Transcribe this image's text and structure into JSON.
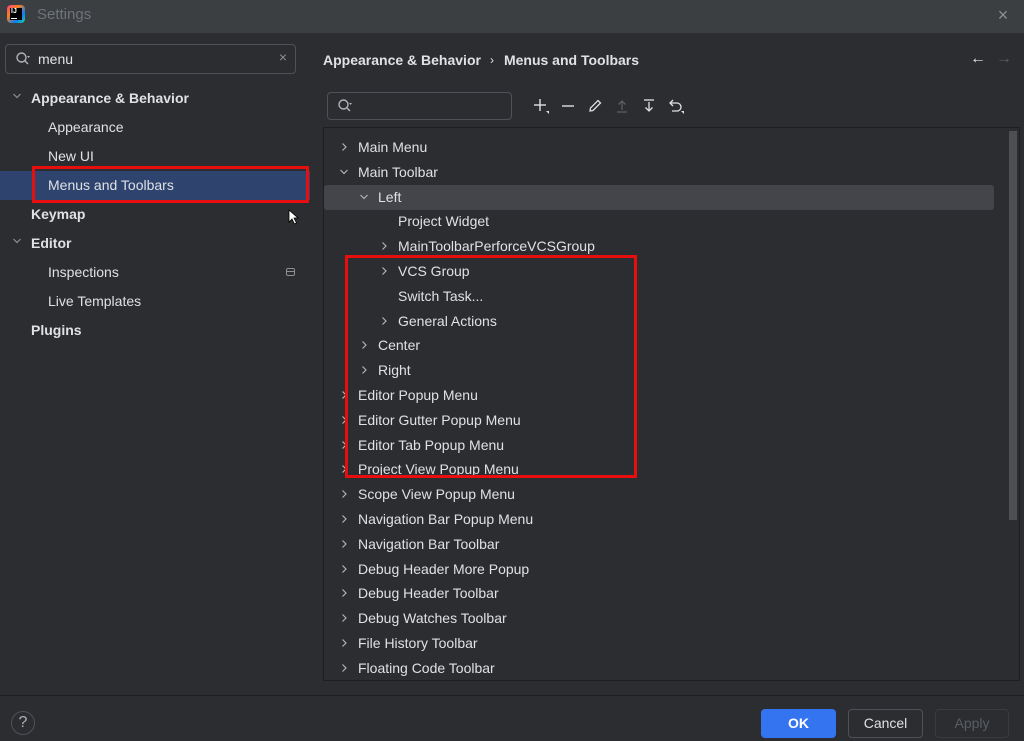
{
  "window": {
    "title": "Settings",
    "close_label": "×"
  },
  "sidebar": {
    "search": {
      "value": "menu",
      "clear_label": "×"
    },
    "items": [
      {
        "label": "Appearance & Behavior",
        "level": 0,
        "bold": true,
        "expanded": true
      },
      {
        "label": "Appearance",
        "level": 1,
        "bold": false
      },
      {
        "label": "New UI",
        "level": 1,
        "bold": false
      },
      {
        "label": "Menus and Toolbars",
        "level": 1,
        "bold": false,
        "selected": true
      },
      {
        "label": "Keymap",
        "level": 0,
        "bold": true
      },
      {
        "label": "Editor",
        "level": 0,
        "bold": true,
        "expanded": true
      },
      {
        "label": "Inspections",
        "level": 1,
        "bold": false,
        "badge_icon": "project-settings-icon"
      },
      {
        "label": "Live Templates",
        "level": 1,
        "bold": false
      },
      {
        "label": "Plugins",
        "level": 0,
        "bold": true
      }
    ]
  },
  "main": {
    "breadcrumb": [
      "Appearance & Behavior",
      "Menus and Toolbars"
    ],
    "breadcrumb_separator": "›",
    "nav": {
      "back": "←",
      "forward": "→"
    },
    "tree_search": {
      "value": "",
      "placeholder": ""
    },
    "toolbar": [
      {
        "name": "add-icon",
        "enabled": true
      },
      {
        "name": "remove-icon",
        "enabled": true
      },
      {
        "name": "edit-icon",
        "enabled": true
      },
      {
        "name": "move-up-icon",
        "enabled": false
      },
      {
        "name": "move-down-icon",
        "enabled": true
      },
      {
        "name": "restore-icon",
        "enabled": true
      }
    ],
    "tree": [
      {
        "label": "Main Menu",
        "level": 0,
        "has_children": true,
        "expanded": false
      },
      {
        "label": "Main Toolbar",
        "level": 0,
        "has_children": true,
        "expanded": true
      },
      {
        "label": "Left",
        "level": 1,
        "has_children": true,
        "expanded": true,
        "selected": true
      },
      {
        "label": "Project Widget",
        "level": 2,
        "has_children": false
      },
      {
        "label": "MainToolbarPerforceVCSGroup",
        "level": 2,
        "has_children": true,
        "expanded": false
      },
      {
        "label": "VCS Group",
        "level": 2,
        "has_children": true,
        "expanded": false
      },
      {
        "label": "Switch Task...",
        "level": 2,
        "has_children": false
      },
      {
        "label": "General Actions",
        "level": 2,
        "has_children": true,
        "expanded": false
      },
      {
        "label": "Center",
        "level": 1,
        "has_children": true,
        "expanded": false
      },
      {
        "label": "Right",
        "level": 1,
        "has_children": true,
        "expanded": false
      },
      {
        "label": "Editor Popup Menu",
        "level": 0,
        "has_children": true,
        "expanded": false
      },
      {
        "label": "Editor Gutter Popup Menu",
        "level": 0,
        "has_children": true,
        "expanded": false
      },
      {
        "label": "Editor Tab Popup Menu",
        "level": 0,
        "has_children": true,
        "expanded": false
      },
      {
        "label": "Project View Popup Menu",
        "level": 0,
        "has_children": true,
        "expanded": false
      },
      {
        "label": "Scope View Popup Menu",
        "level": 0,
        "has_children": true,
        "expanded": false
      },
      {
        "label": "Navigation Bar Popup Menu",
        "level": 0,
        "has_children": true,
        "expanded": false
      },
      {
        "label": "Navigation Bar Toolbar",
        "level": 0,
        "has_children": true,
        "expanded": false
      },
      {
        "label": "Debug Header More Popup",
        "level": 0,
        "has_children": true,
        "expanded": false
      },
      {
        "label": "Debug Header Toolbar",
        "level": 0,
        "has_children": true,
        "expanded": false
      },
      {
        "label": "Debug Watches Toolbar",
        "level": 0,
        "has_children": true,
        "expanded": false
      },
      {
        "label": "File History Toolbar",
        "level": 0,
        "has_children": true,
        "expanded": false
      },
      {
        "label": "Floating Code Toolbar",
        "level": 0,
        "has_children": true,
        "expanded": false
      }
    ],
    "scroll_position_fraction": 0.0,
    "scroll_visible_fraction": 0.71
  },
  "footer": {
    "help_label": "?",
    "ok_label": "OK",
    "cancel_label": "Cancel",
    "apply_label": "Apply",
    "apply_enabled": false
  },
  "colors": {
    "accent": "#3574f0",
    "selection": "#2e436e",
    "tree_selection": "#43454a",
    "annotation_highlight": "#e80e0e",
    "background": "#2b2d30",
    "titlebar": "#3c3f41"
  }
}
